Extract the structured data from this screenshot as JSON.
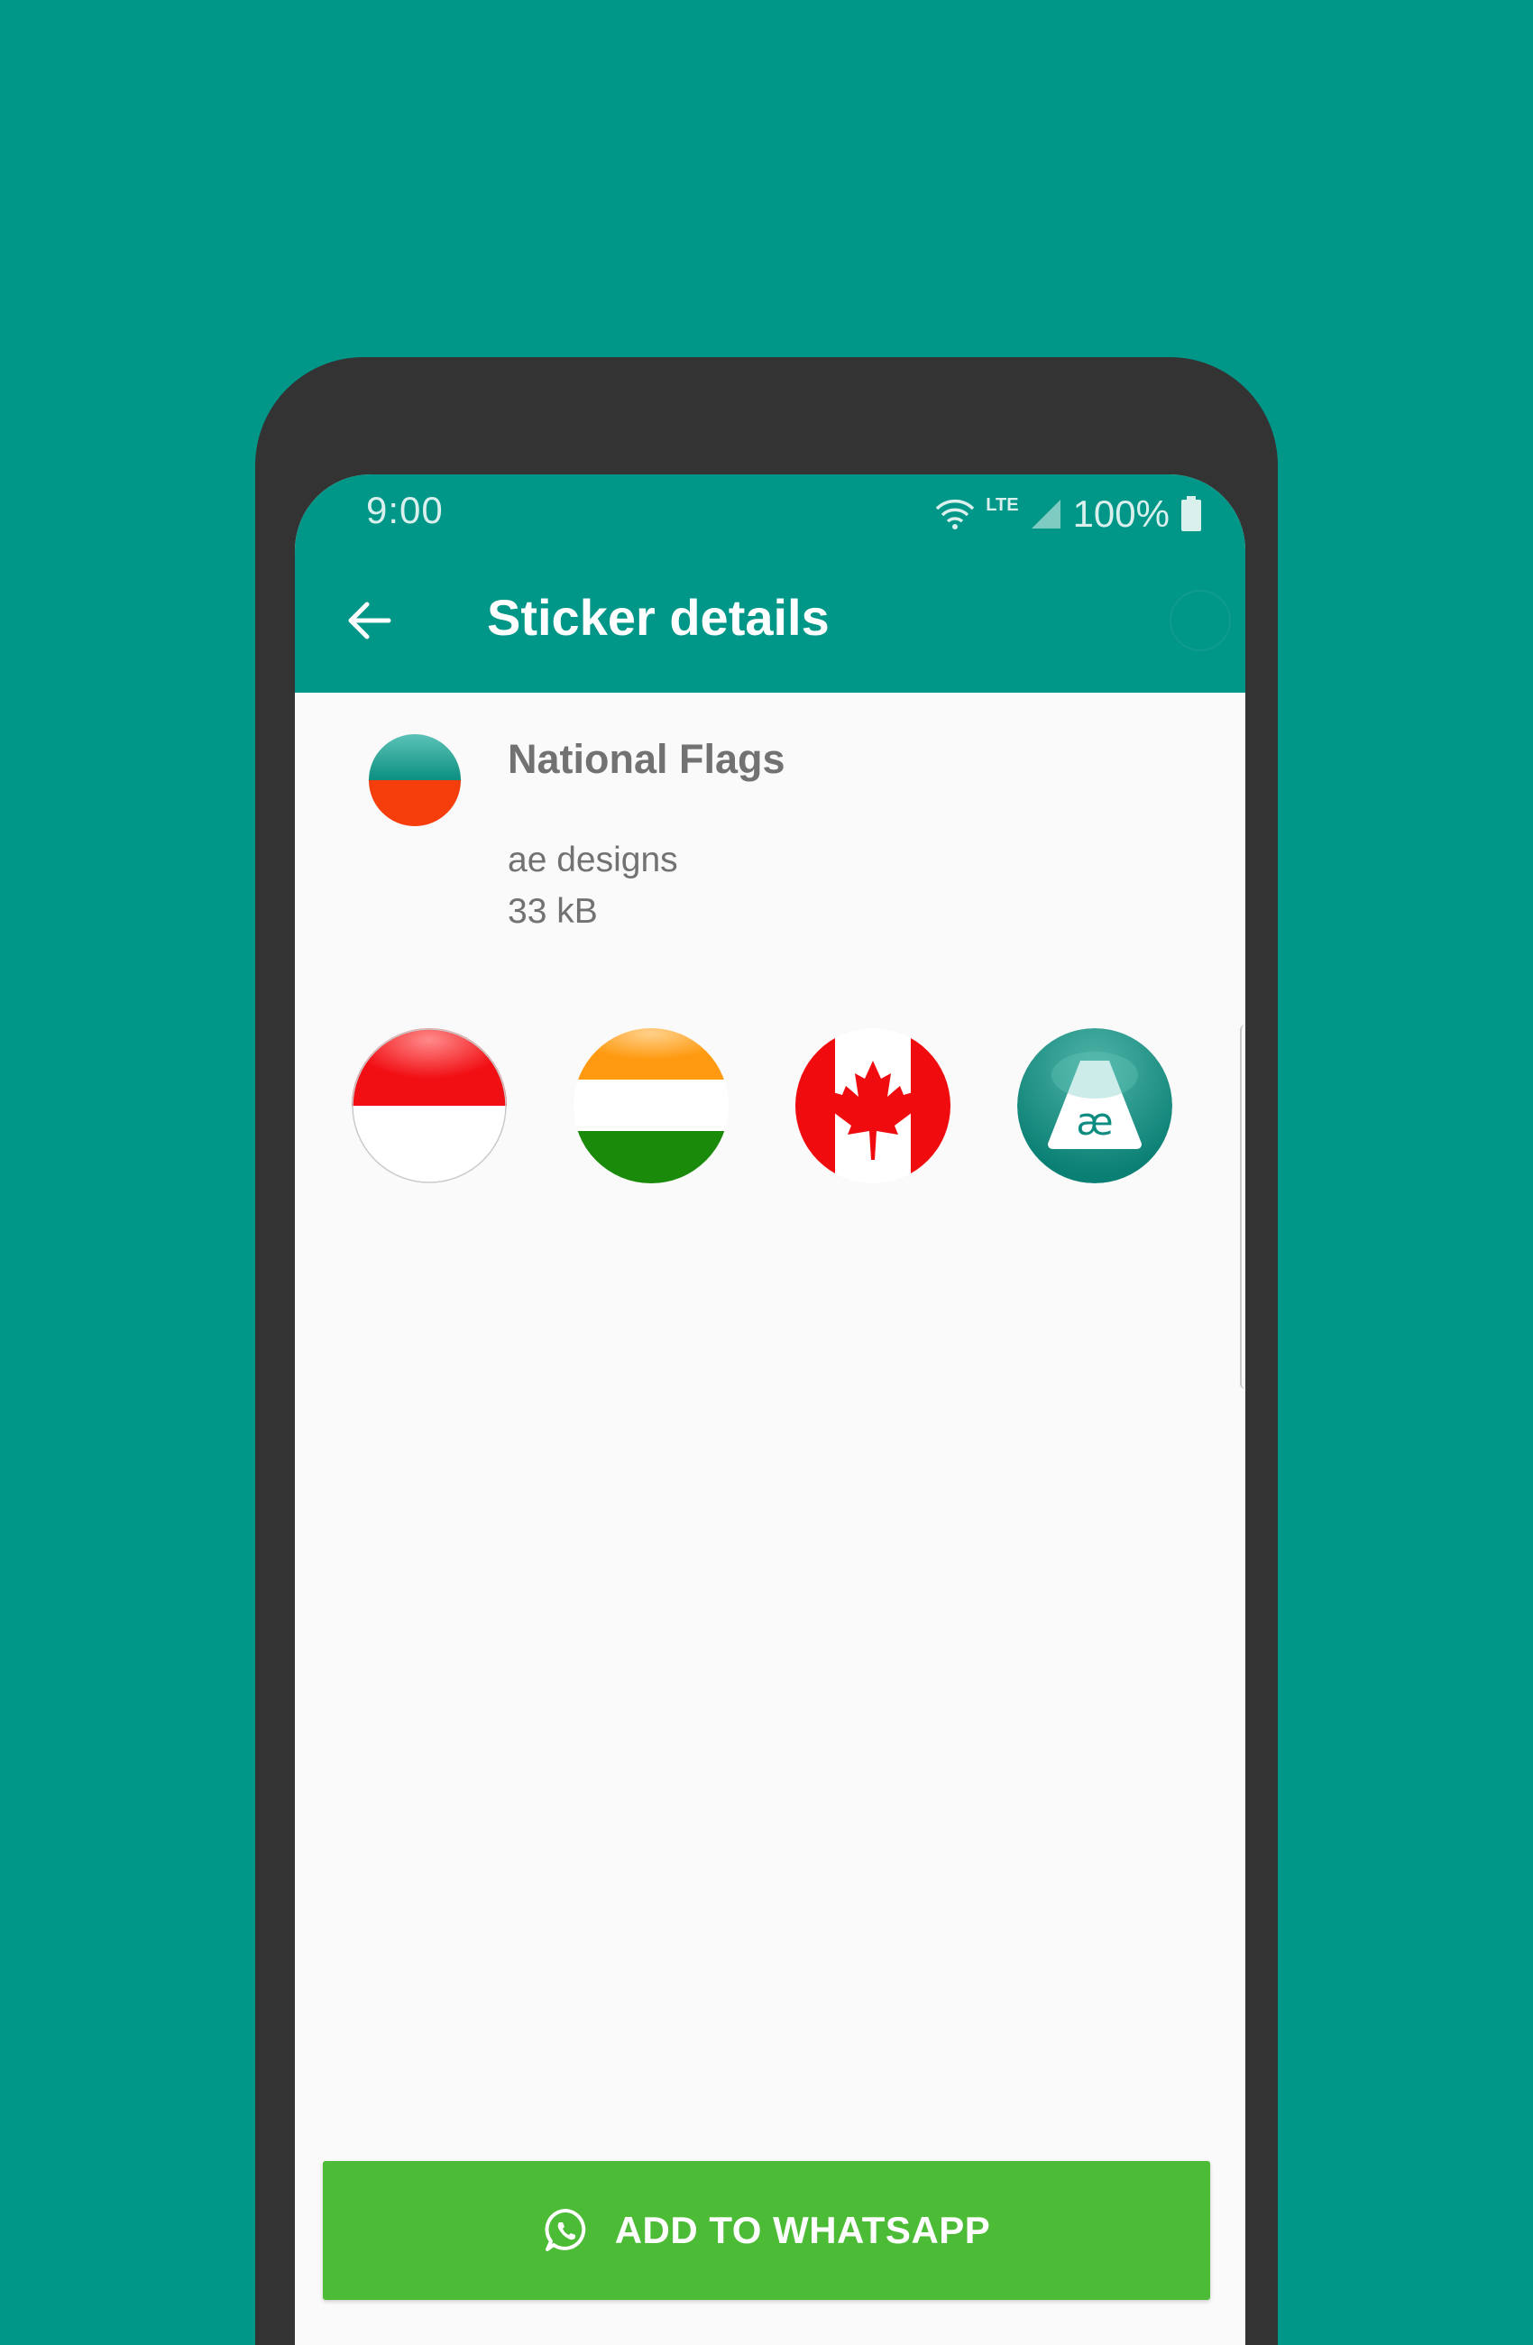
{
  "status_bar": {
    "time": "9:00",
    "network": "LTE",
    "battery": "100%"
  },
  "toolbar": {
    "title": "Sticker details"
  },
  "pack": {
    "name": "National Flags",
    "publisher": "ae designs",
    "size": "33 kB",
    "icon": "teal-red-circle-icon"
  },
  "stickers": [
    {
      "icon": "indonesia-flag-sticker"
    },
    {
      "icon": "india-flag-sticker"
    },
    {
      "icon": "canada-flag-sticker"
    },
    {
      "icon": "ae-designs-logo-sticker",
      "text": "æ"
    }
  ],
  "add_button": {
    "label": "ADD TO WHATSAPP",
    "icon": "whatsapp-icon"
  },
  "colors": {
    "background": "#009688",
    "toolbar": "#009688",
    "button": "#4cbb36",
    "bezel": "#333333"
  }
}
